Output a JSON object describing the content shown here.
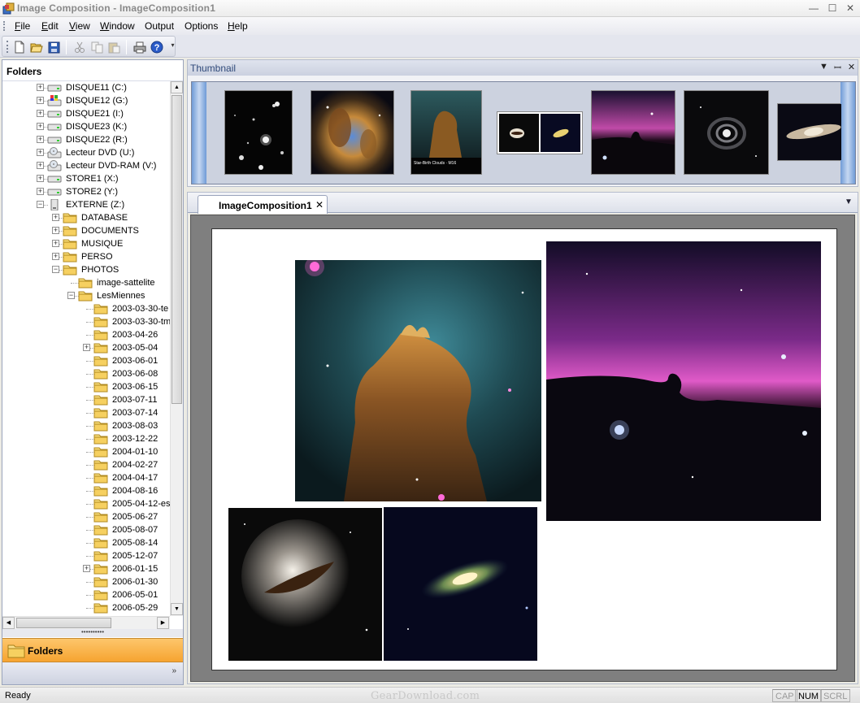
{
  "window": {
    "title": "Image Composition - ImageComposition1",
    "controls": [
      "minimize-icon",
      "maximize-icon",
      "close-icon"
    ]
  },
  "menu": {
    "items": [
      "File",
      "Edit",
      "View",
      "Window",
      "Output",
      "Options",
      "Help"
    ]
  },
  "toolbar": {
    "buttons": [
      "new-icon",
      "open-icon",
      "save-icon",
      "cut-icon",
      "copy-icon",
      "paste-icon",
      "print-icon",
      "help-icon"
    ]
  },
  "folders_panel": {
    "header": "Folders",
    "drives": [
      "DISQUE11 (C:)",
      "DISQUE12 (G:)",
      "DISQUE21 (I:)",
      "DISQUE23 (K:)",
      "DISQUE22 (R:)",
      "Lecteur DVD (U:)",
      "Lecteur DVD-RAM (V:)",
      "STORE1 (X:)",
      "STORE2 (Y:)",
      "EXTERNE (Z:)"
    ],
    "externe_children": [
      "DATABASE",
      "DOCUMENTS",
      "MUSIQUE",
      "PERSO",
      "PHOTOS"
    ],
    "photos_children": [
      "image-sattelite",
      "LesMiennes"
    ],
    "lesmiennes_children": [
      "2003-03-30-te",
      "2003-03-30-tm",
      "2003-04-26",
      "2003-05-04",
      "2003-06-01",
      "2003-06-08",
      "2003-06-15",
      "2003-07-11",
      "2003-07-14",
      "2003-08-03",
      "2003-12-22",
      "2004-01-10",
      "2004-02-27",
      "2004-04-17",
      "2004-08-16",
      "2005-04-12-es",
      "2005-06-27",
      "2005-08-07",
      "2005-08-14",
      "2005-12-07",
      "2006-01-15",
      "2006-01-30",
      "2006-05-01",
      "2006-05-29"
    ],
    "nav_button": "Folders"
  },
  "thumbnail_panel": {
    "title": "Thumbnail",
    "thumbnails": [
      "galaxy-cluster",
      "eagle-nebula",
      "pillars-star-birth",
      "two-galaxies",
      "horsehead-nebula",
      "spiral-galaxy",
      "edge-on-galaxy"
    ],
    "pillar_caption": "Star-Birth Clouds · M16"
  },
  "document": {
    "tab_label": "ImageComposition1"
  },
  "status": {
    "ready": "Ready",
    "watermark": "GearDownload.com",
    "indicators": [
      "CAP",
      "NUM",
      "SCRL"
    ]
  },
  "colors": {
    "accent": "#f6a431",
    "header_text": "#304a7a"
  }
}
